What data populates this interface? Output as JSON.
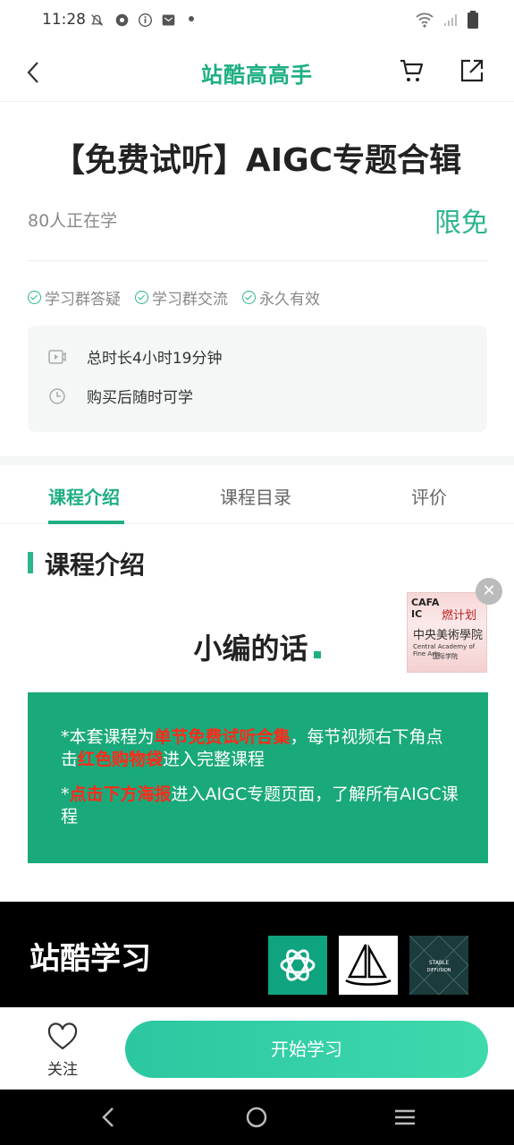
{
  "status_bar": {
    "time": "11:28"
  },
  "header": {
    "brand": "站酷高高手"
  },
  "course": {
    "title": "【免费试听】AIGC专题合辑",
    "learners": "80人正在学",
    "price_tag": "限免",
    "features": [
      "学习群答疑",
      "学习群交流",
      "永久有效"
    ],
    "info": {
      "duration": "总时长4小时19分钟",
      "access": "购买后随时可学"
    }
  },
  "tabs": [
    "课程介绍",
    "课程目录",
    "评价"
  ],
  "section": {
    "title": "课程介绍"
  },
  "editor_heading": "小编的话",
  "badge": {
    "line1": "CAFA",
    "line1b": "IC",
    "fire": "燃计划",
    "school": "中央美術學院",
    "english": "Central Academy of Fine Arts",
    "intl": "国际学院"
  },
  "notice": {
    "p1_pre": "*本套课程为",
    "p1_red1": "单节免费试听合集",
    "p1_mid": "，每节视频右下角点击",
    "p1_red2": "红色购物袋",
    "p1_post": "进入完整课程",
    "p2_pre": "*",
    "p2_red": "点击下方海报",
    "p2_post": "进入AIGC专题页面，了解所有AIGC课程"
  },
  "banner": {
    "title": "站酷学习",
    "logos": [
      "openai-logo",
      "midjourney-logo",
      "stable-diffusion-logo"
    ],
    "sd_text": "STABLE DIFFUSION"
  },
  "bottom": {
    "follow_label": "关注",
    "start_label": "开始学习"
  },
  "colors": {
    "accent": "#1eae83",
    "notice_bg": "#1aa97a",
    "highlight_red": "#ff2a1a"
  }
}
